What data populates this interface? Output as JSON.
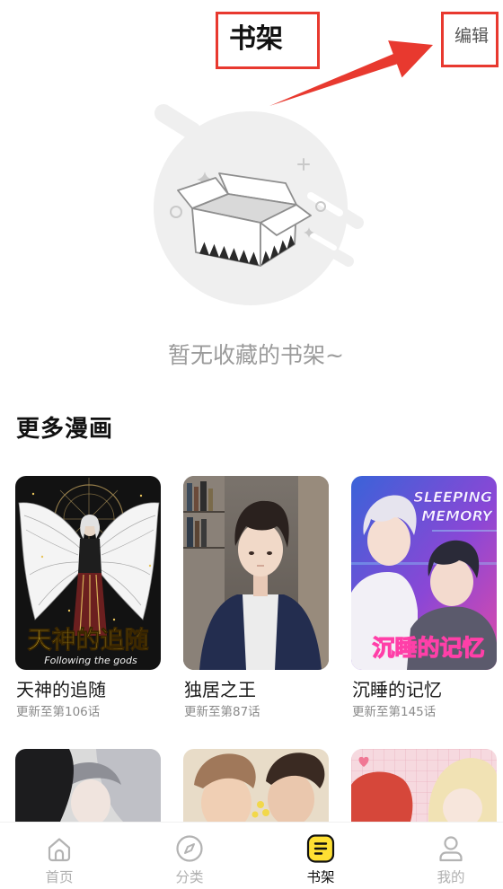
{
  "header": {
    "title": "书架",
    "edit_label": "编辑"
  },
  "empty_state": {
    "message": "暂无收藏的书架~",
    "illustration": "empty-box-icon"
  },
  "more_section": {
    "heading": "更多漫画"
  },
  "comics": [
    {
      "title": "天神的追随",
      "update": "更新至第106话",
      "cover_lettering": {
        "title": "天神的追随",
        "subtitle": "Following the gods"
      }
    },
    {
      "title": "独居之王",
      "update": "更新至第87话"
    },
    {
      "title": "沉睡的记忆",
      "update": "更新至第145话",
      "cover_lettering": {
        "title": "沉睡的记忆",
        "lines": [
          "SLEEPING",
          "MEMORY"
        ]
      }
    }
  ],
  "tabbar": {
    "items": [
      {
        "label": "首页",
        "icon": "home-icon",
        "active": false
      },
      {
        "label": "分类",
        "icon": "compass-icon",
        "active": false
      },
      {
        "label": "书架",
        "icon": "bookshelf-icon",
        "active": true
      },
      {
        "label": "我的",
        "icon": "profile-icon",
        "active": false
      }
    ]
  },
  "theme": {
    "accent": "#ffe033",
    "annotation": "#e8392f",
    "text_primary": "#141414",
    "text_muted": "#9b9b9b"
  }
}
